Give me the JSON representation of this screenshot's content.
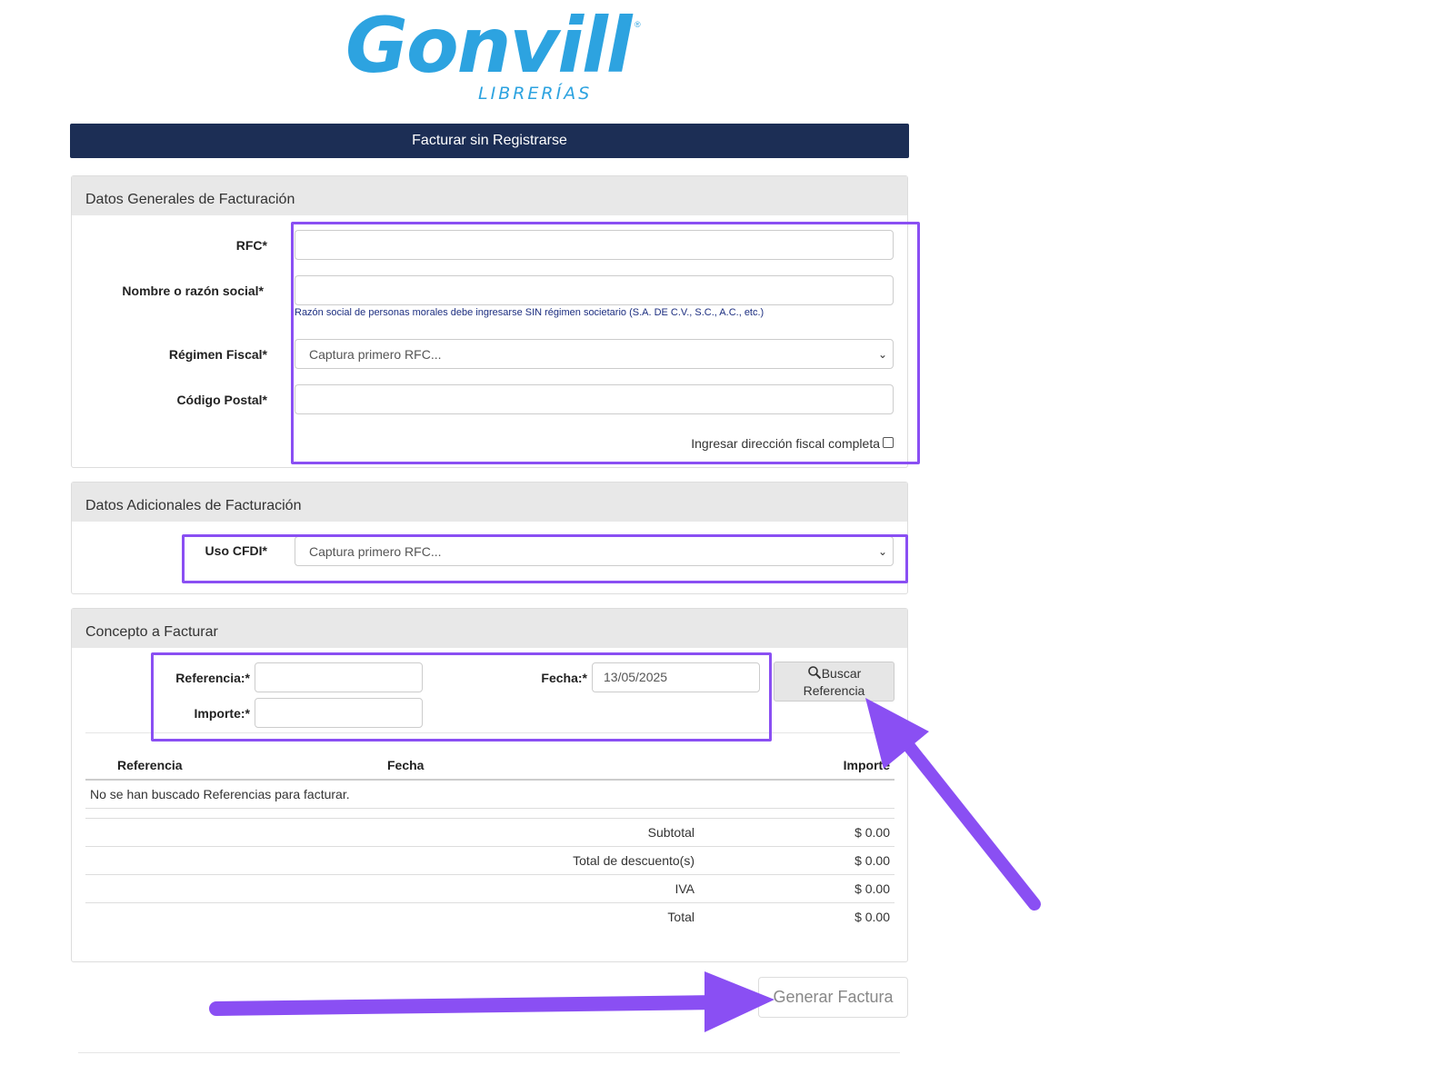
{
  "logo": {
    "name": "Gonvill",
    "sub": "LIBRERÍAS",
    "reg": "®"
  },
  "header": {
    "title": "Facturar sin Registrarse"
  },
  "general": {
    "title": "Datos Generales de Facturación",
    "rfc_label": "RFC*",
    "rfc_value": "",
    "nombre_label": "Nombre o razón social*",
    "nombre_value": "",
    "nombre_help": "Razón social de personas morales debe ingresarse SIN régimen societario (S.A. DE C.V., S.C., A.C., etc.)",
    "regimen_label": "Régimen Fiscal*",
    "regimen_value": "Captura primero RFC...",
    "cp_label": "Código Postal*",
    "cp_value": "",
    "direccion_label": "Ingresar dirección fiscal completa"
  },
  "adicionales": {
    "title": "Datos Adicionales de Facturación",
    "uso_label": "Uso CFDI*",
    "uso_value": "Captura primero RFC..."
  },
  "concepto": {
    "title": "Concepto a Facturar",
    "referencia_label": "Referencia:*",
    "referencia_value": "",
    "importe_label": "Importe:*",
    "importe_value": "",
    "fecha_label": "Fecha:*",
    "fecha_value": "13/05/2025",
    "buscar_label_1": "Buscar",
    "buscar_label_2": "Referencia",
    "table": {
      "headers": [
        "Referencia",
        "Fecha",
        "Importe"
      ],
      "empty": "No se han buscado Referencias para facturar."
    },
    "totals": [
      {
        "label": "Subtotal",
        "value": "$ 0.00"
      },
      {
        "label": "Total de descuento(s)",
        "value": "$ 0.00"
      },
      {
        "label": "IVA",
        "value": "$ 0.00"
      },
      {
        "label": "Total",
        "value": "$ 0.00"
      }
    ]
  },
  "generar_label": "Generar Factura",
  "colors": {
    "header": "#1c2e55",
    "brand": "#2da3e0",
    "annotation": "#8a4ff3"
  }
}
